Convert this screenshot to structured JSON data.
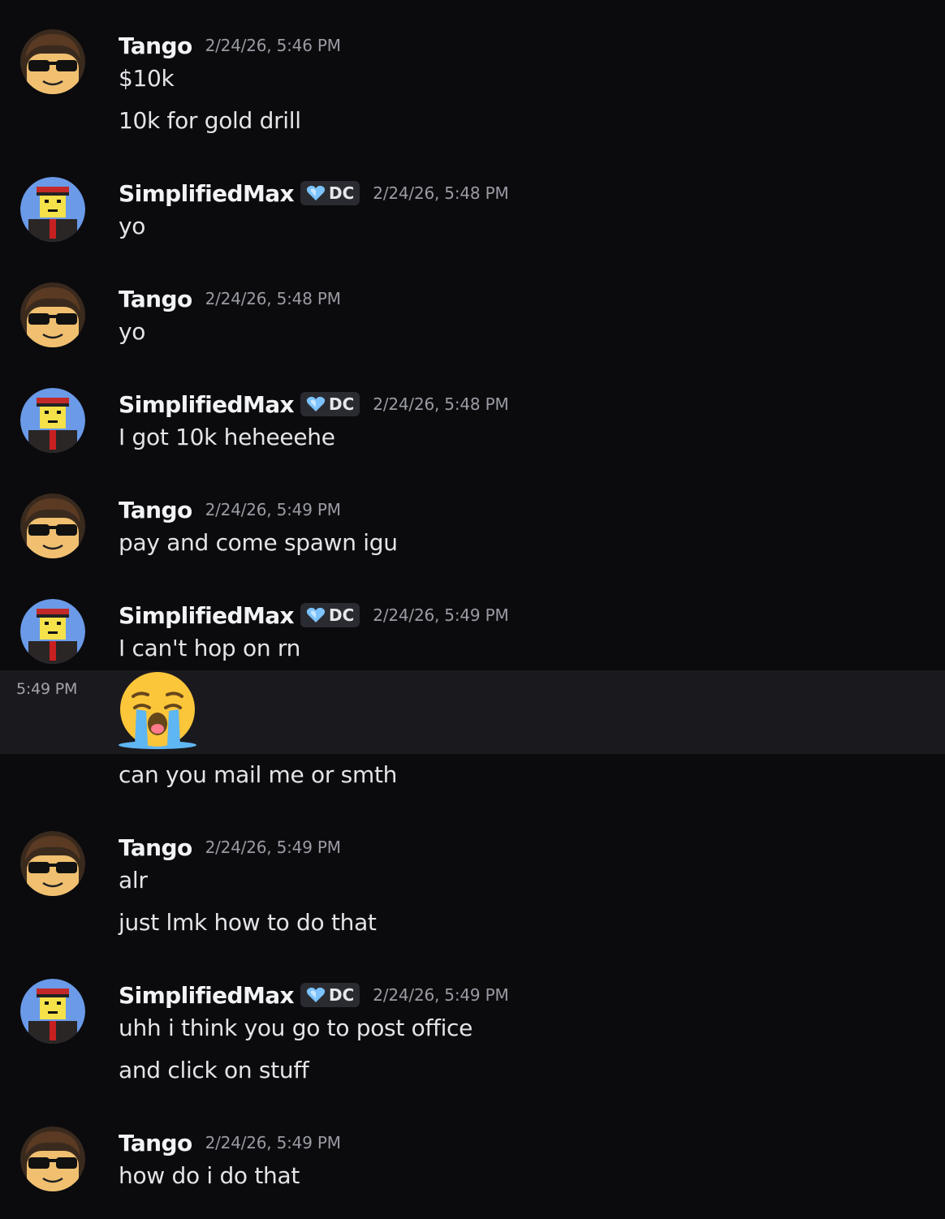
{
  "users": {
    "tango": {
      "name": "Tango"
    },
    "max": {
      "name": "SimplifiedMax",
      "tag": "DC"
    }
  },
  "messages": [
    {
      "author": "Tango",
      "timestamp": "2/24/26, 5:46 PM",
      "lines": [
        "$10k",
        "10k for gold drill"
      ]
    },
    {
      "author": "SimplifiedMax",
      "timestamp": "2/24/26, 5:48 PM",
      "lines": [
        "yo"
      ]
    },
    {
      "author": "Tango",
      "timestamp": "2/24/26, 5:48 PM",
      "lines": [
        "yo"
      ]
    },
    {
      "author": "SimplifiedMax",
      "timestamp": "2/24/26, 5:48 PM",
      "lines": [
        "I got 10k heheeehe"
      ]
    },
    {
      "author": "Tango",
      "timestamp": "2/24/26, 5:49 PM",
      "lines": [
        "pay and come spawn igu"
      ]
    },
    {
      "author": "SimplifiedMax",
      "timestamp": "2/24/26, 5:49 PM",
      "lines": [
        "I can't hop on rn"
      ],
      "hover_time": "5:49 PM",
      "emoji": "loudly-crying-face",
      "after_emoji": "can you mail me or smth"
    },
    {
      "author": "Tango",
      "timestamp": "2/24/26, 5:49 PM",
      "lines": [
        "alr",
        "just lmk how to do that"
      ]
    },
    {
      "author": "SimplifiedMax",
      "timestamp": "2/24/26, 5:49 PM",
      "lines": [
        "uhh i think you go to post office",
        "and click on stuff"
      ]
    },
    {
      "author": "Tango",
      "timestamp": "2/24/26, 5:49 PM",
      "lines": [
        "how do i do that"
      ]
    }
  ],
  "colors": {
    "background": "#0b0b0e",
    "hover_background": "#1a1a1e",
    "username": "#f2f3f5",
    "timestamp": "#9a9ba3",
    "tag_background": "#2a2b31",
    "tag_heart": "#7cc3ff"
  }
}
